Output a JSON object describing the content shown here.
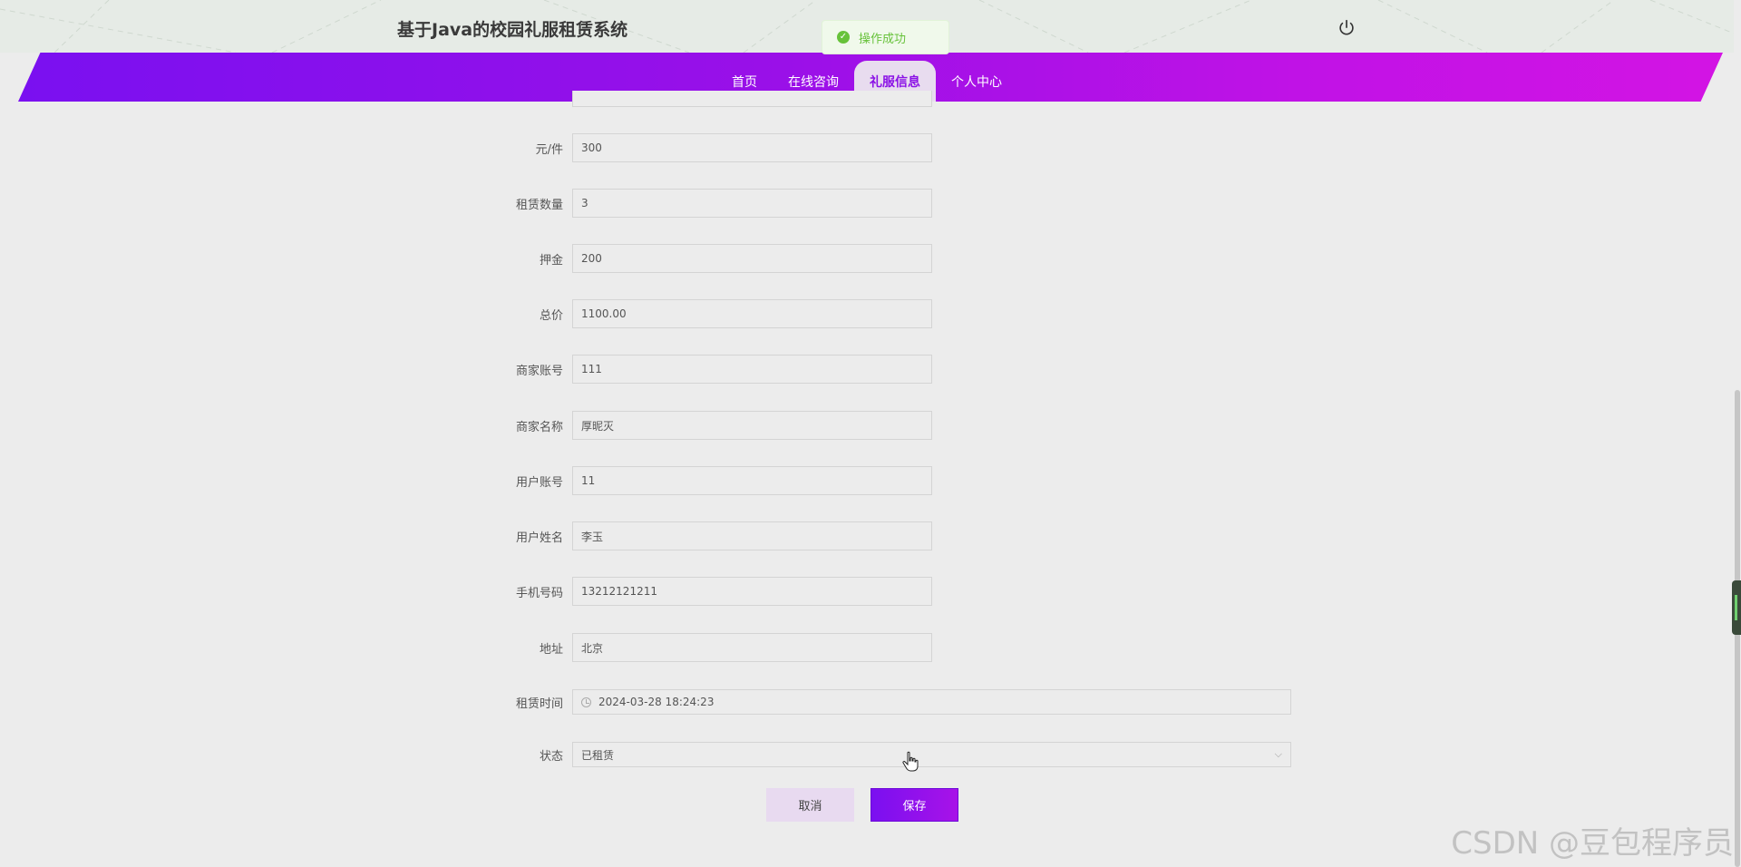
{
  "header": {
    "site_title": "基于Java的校园礼服租赁系统",
    "toast_message": "操作成功"
  },
  "nav": {
    "items": [
      {
        "label": "首页",
        "active": false
      },
      {
        "label": "在线咨询",
        "active": false
      },
      {
        "label": "礼服信息",
        "active": true
      },
      {
        "label": "个人中心",
        "active": false
      }
    ]
  },
  "form": {
    "fields": [
      {
        "label": "元/件",
        "value": "300"
      },
      {
        "label": "租赁数量",
        "value": "3"
      },
      {
        "label": "押金",
        "value": "200"
      },
      {
        "label": "总价",
        "value": "1100.00"
      },
      {
        "label": "商家账号",
        "value": "111"
      },
      {
        "label": "商家名称",
        "value": "厚昵灭"
      },
      {
        "label": "用户账号",
        "value": "11"
      },
      {
        "label": "用户姓名",
        "value": "李玉"
      },
      {
        "label": "手机号码",
        "value": "13212121211"
      },
      {
        "label": "地址",
        "value": "北京"
      }
    ],
    "rent_time": {
      "label": "租赁时间",
      "value": "2024-03-28 18:24:23"
    },
    "status": {
      "label": "状态",
      "value": "已租赁"
    },
    "cancel_label": "取消",
    "save_label": "保存"
  },
  "watermark": "CSDN @豆包程序员",
  "colors": {
    "nav_gradient_start": "#7a10f0",
    "nav_gradient_end": "#d314e4",
    "active_tab_bg": "#e8dcef",
    "toast_green": "#67c23a"
  }
}
